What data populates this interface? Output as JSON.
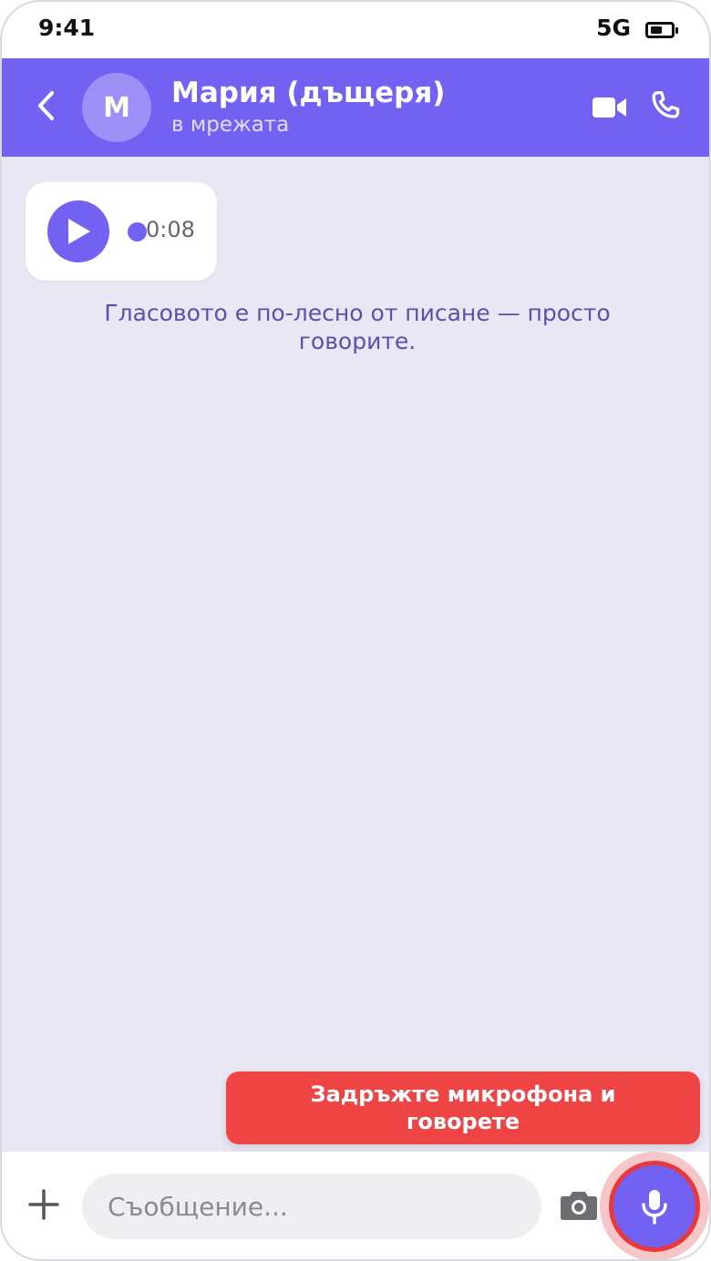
{
  "status_bar": {
    "time": "9:41",
    "network": "5G"
  },
  "header": {
    "avatar_initial": "М",
    "contact_name": "Мария (дъщеря)",
    "contact_status": "в мрежата"
  },
  "messages": {
    "voice_message": {
      "duration": "0:08"
    },
    "hint": "Гласовото е по-лесно от писане — просто говорите."
  },
  "tooltip": {
    "text": "Задръжте микрофона и говорете"
  },
  "composer": {
    "placeholder": "Съобщение..."
  },
  "colors": {
    "accent": "#7361f2",
    "background": "#e9e7f4",
    "tooltip": "#ee4444",
    "mic_border": "#e9383c"
  },
  "icons": {
    "back": "chevron-left-icon",
    "video": "video-camera-icon",
    "call": "phone-icon",
    "play": "play-icon",
    "attach": "plus-icon",
    "camera": "camera-icon",
    "mic": "microphone-icon"
  }
}
